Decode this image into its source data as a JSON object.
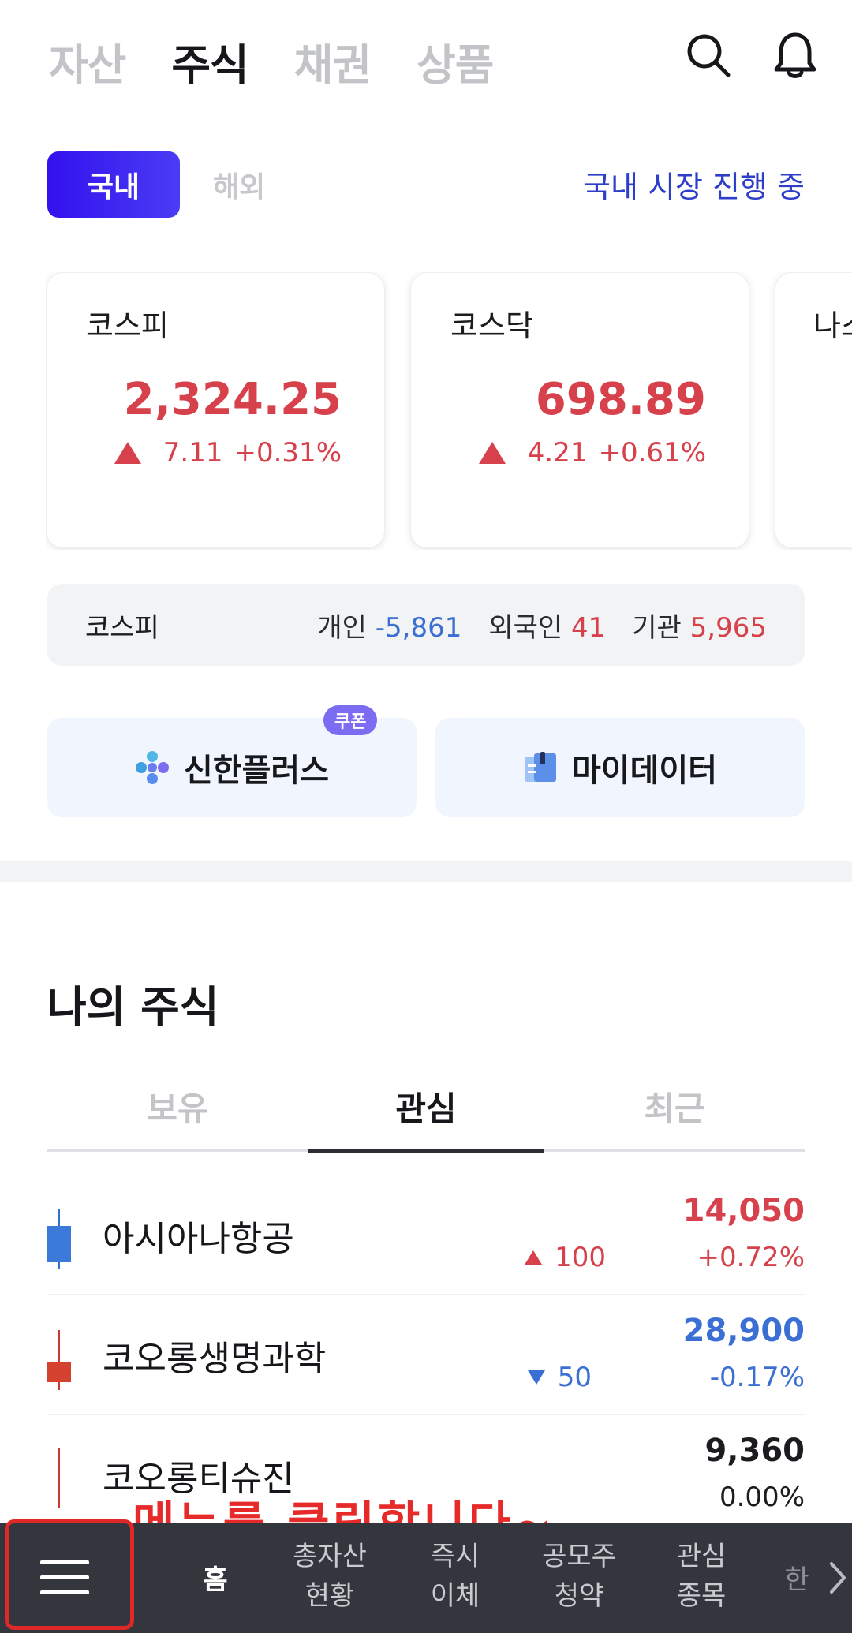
{
  "top_tabs": [
    {
      "label": "자산",
      "active": false
    },
    {
      "label": "주식",
      "active": true
    },
    {
      "label": "채권",
      "active": false
    },
    {
      "label": "상품",
      "active": false
    }
  ],
  "icons": {
    "search": "search-icon",
    "notifications": "bell-icon"
  },
  "market_toggle": {
    "domestic": "국내",
    "overseas": "해외",
    "status": "국내 시장 진행 중"
  },
  "indices": [
    {
      "name": "코스피",
      "value": "2,324.25",
      "change": "7.11",
      "pct": "+0.31%"
    },
    {
      "name": "코스닥",
      "value": "698.89",
      "change": "4.21",
      "pct": "+0.61%"
    },
    {
      "name": "나스"
    }
  ],
  "investors": {
    "market": "코스피",
    "individual_label": "개인",
    "individual_value": "-5,861",
    "foreign_label": "외국인",
    "foreign_value": "41",
    "institution_label": "기관",
    "institution_value": "5,965"
  },
  "promos": {
    "shinhan_plus": "신한플러스",
    "coupon_badge": "쿠폰",
    "my_data": "마이데이터"
  },
  "my_stocks": {
    "title": "나의 주식",
    "tabs": [
      {
        "label": "보유",
        "active": false
      },
      {
        "label": "관심",
        "active": true
      },
      {
        "label": "최근",
        "active": false
      }
    ],
    "items": [
      {
        "name": "아시아나항공",
        "price": "14,050",
        "change": "100",
        "pct": "+0.72%",
        "direction": "up"
      },
      {
        "name": "코오롱생명과학",
        "price": "28,900",
        "change": "50",
        "pct": "-0.17%",
        "direction": "down"
      },
      {
        "name": "코오롱티슈진",
        "price": "9,360",
        "change": "",
        "pct": "0.00%",
        "direction": "flat"
      }
    ]
  },
  "annotation": "메뉴를 클릭합니다~",
  "bottom_nav": {
    "home": "홈",
    "total_assets_1": "총자산",
    "total_assets_2": "현황",
    "instant_1": "즉시",
    "instant_2": "이체",
    "ipo_1": "공모주",
    "ipo_2": "청약",
    "watch_1": "관심",
    "watch_2": "종목",
    "more": "한"
  },
  "colors": {
    "up": "#d7414b",
    "down": "#3b6fd4",
    "accent": "#3311ee",
    "nav_bg": "#33363d",
    "annotation": "#e62a2a"
  }
}
